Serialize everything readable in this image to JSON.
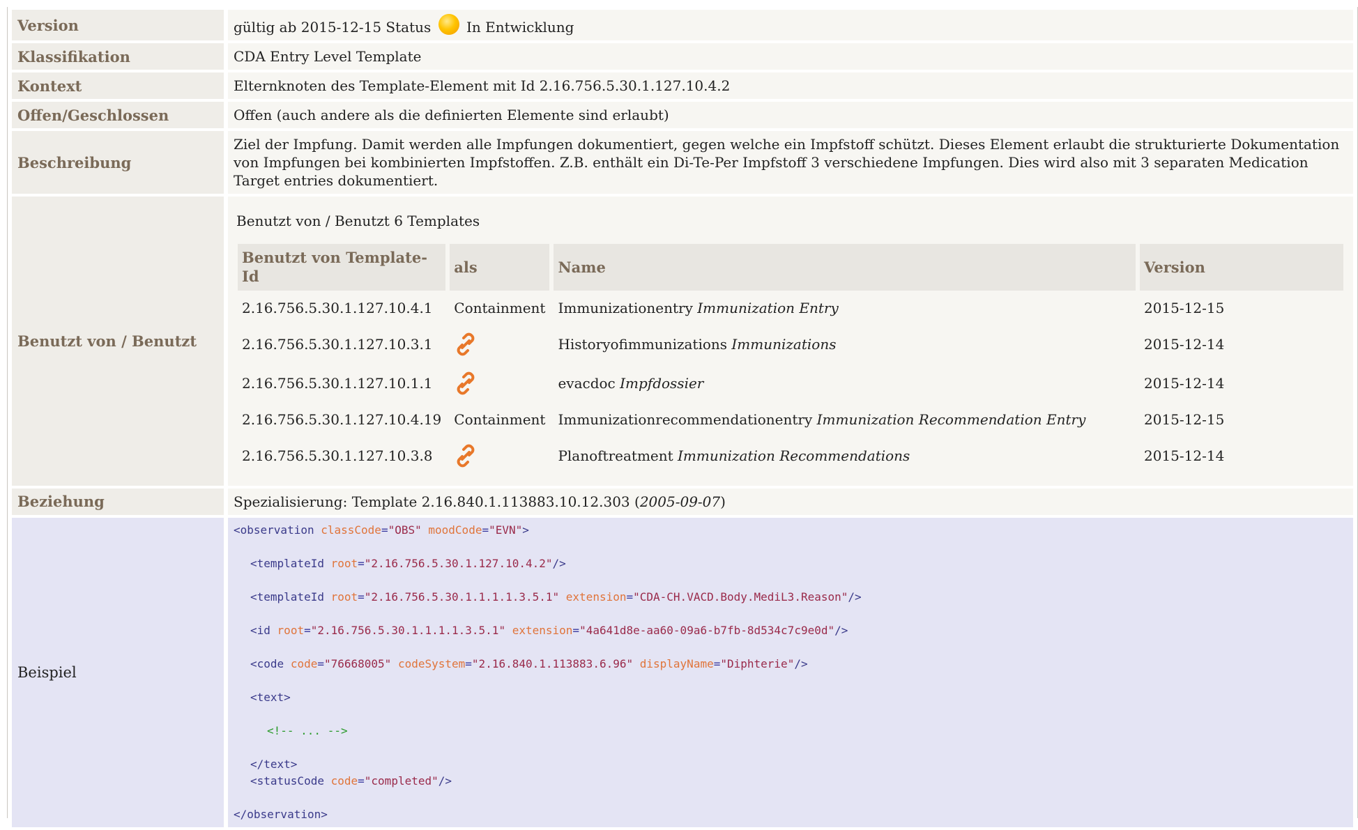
{
  "rows": {
    "version": {
      "label": "Version",
      "valid_from": "gültig ab 2015-12-15 Status",
      "status": "In Entwicklung"
    },
    "klassifikation": {
      "label": "Klassifikation",
      "value": "CDA Entry Level Template"
    },
    "kontext": {
      "label": "Kontext",
      "value": "Elternknoten des Template-Element mit Id 2.16.756.5.30.1.127.10.4.2"
    },
    "offen": {
      "label": "Offen/Geschlossen",
      "value": "Offen (auch andere als die definierten Elemente sind erlaubt)"
    },
    "beschreibung": {
      "label": "Beschreibung",
      "value": "Ziel der Impfung. Damit werden alle Impfungen dokumentiert, gegen welche ein Impfstoff schützt. Dieses Element erlaubt die strukturierte Dokumentation von Impfungen bei kombinierten Impfstoffen. Z.B. enthält ein Di-Te-Per Impfstoff 3 verschiedene Impfungen. Dies wird also mit 3 separaten Medication Target entries dokumentiert."
    },
    "benutzt": {
      "label": "Benutzt von / Benutzt",
      "subtitle": "Benutzt von / Benutzt 6 Templates",
      "headers": {
        "id": "Benutzt von Template-Id",
        "als": "als",
        "name": "Name",
        "version": "Version"
      },
      "items": [
        {
          "id": "2.16.756.5.30.1.127.10.4.1",
          "als": "Containment",
          "name": "Immunizationentry",
          "name_italic": "Immunization Entry",
          "version": "2015-12-15"
        },
        {
          "id": "2.16.756.5.30.1.127.10.3.1",
          "als": "",
          "icon": "link-icon",
          "name": "Historyofimmunizations",
          "name_italic": "Immunizations",
          "version": "2015-12-14"
        },
        {
          "id": "2.16.756.5.30.1.127.10.1.1",
          "als": "",
          "icon": "link-icon",
          "name": "evacdoc",
          "name_italic": "Impfdossier",
          "version": "2015-12-14"
        },
        {
          "id": "2.16.756.5.30.1.127.10.4.19",
          "als": "Containment",
          "name": "Immunizationrecommendationentry",
          "name_italic": "Immunization Recommendation Entry",
          "version": "2015-12-15"
        },
        {
          "id": "2.16.756.5.30.1.127.10.3.8",
          "als": "",
          "icon": "link-icon",
          "name": "Planoftreatment",
          "name_italic": "Immunization Recommendations",
          "version": "2015-12-14"
        }
      ]
    },
    "beziehung": {
      "label": "Beziehung",
      "prefix": "Spezialisierung: Template 2.16.840.1.113883.10.12.303 (",
      "date": "2005-09-07",
      "suffix": ")"
    },
    "beispiel": {
      "label": "Beispiel"
    }
  },
  "code": {
    "observation_open": "<observation",
    "classCode_attr": "classCode",
    "classCode_val": "\"OBS\"",
    "moodCode_attr": "moodCode",
    "moodCode_val": "\"EVN\"",
    "templateId1_tag": "<templateId",
    "templateId1_root": "\"2.16.756.5.30.1.127.10.4.2\"",
    "templateId2_tag": "<templateId",
    "templateId2_root": "\"2.16.756.5.30.1.1.1.1.3.5.1\"",
    "templateId2_ext": "\"CDA-CH.VACD.Body.MediL3.Reason\"",
    "id_tag": "<id",
    "id_root": "\"2.16.756.5.30.1.1.1.1.3.5.1\"",
    "id_ext": "\"4a641d8e-aa60-09a6-b7fb-8d534c7c9e0d\"",
    "code_tag": "<code",
    "code_code": "\"76668005\"",
    "code_system": "\"2.16.840.1.113883.6.96\"",
    "code_display": "\"Diphterie\"",
    "text_open": "<text>",
    "comment": "<!-- ... -->",
    "text_close": "</text>",
    "status_tag": "<statusCode",
    "status_code": "\"completed\"",
    "observation_close": "</observation>"
  },
  "colors": {
    "header_text": "#7a6a58",
    "header_bg": "#efede8",
    "example_bg": "#e4e4f4",
    "status_dot": "#ffc400",
    "link_icon": "#e8782a"
  }
}
